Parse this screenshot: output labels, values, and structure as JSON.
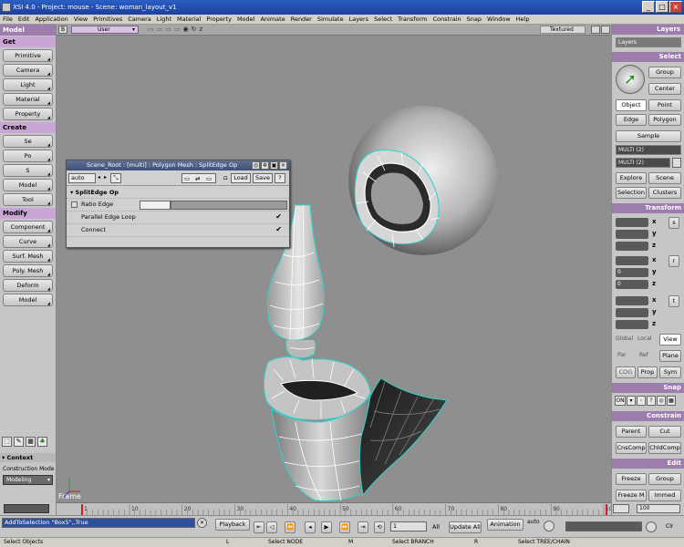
{
  "window": {
    "title": "XSI 4.0 - Project: mouse - Scene: woman_layout_v1"
  },
  "menu": [
    "File",
    "Edit",
    "Application",
    "View",
    "Primitives",
    "Camera",
    "Light",
    "Material",
    "Property",
    "Model",
    "Animate",
    "Render",
    "Simulate",
    "Layers",
    "Select",
    "Transform",
    "Constrain",
    "Snap",
    "Window",
    "Help"
  ],
  "left": {
    "model_tab": "Model",
    "get_header": "Get",
    "get_buttons": [
      "Primitive",
      "Camera",
      "Light",
      "Material",
      "Property"
    ],
    "create_header": "Create",
    "create_partial": [
      "Se",
      "Po",
      "S",
      "Model",
      "Tool"
    ],
    "modify_header": "Modify",
    "modify_buttons": [
      "Component",
      "Curve",
      "Surf. Mesh",
      "Poly. Mesh",
      "Deform",
      "Model"
    ],
    "context_label": "Context",
    "construction_mode_label": "Construction Mode",
    "construction_mode_value": "Modeling"
  },
  "viewport": {
    "camera": "User",
    "display_mode": "Textured",
    "frame_label": "Frame"
  },
  "ppg": {
    "title": "Scene_Root : [multi] : Polygon Mesh : SplitEdge Op",
    "auto_label": "auto",
    "load_label": "Load",
    "save_label": "Save",
    "help_label": "?",
    "section": "SplitEdge Op",
    "ratio_label": "Ratio Edge",
    "parallel_label": "Parallel Edge Loop",
    "connect_label": "Connect"
  },
  "right": {
    "layers_header": "Layers",
    "layer_value": "Layers",
    "select_header": "Select",
    "group": "Group",
    "center": "Center",
    "object": "Object",
    "point": "Point",
    "edge": "Edge",
    "polygon": "Polygon",
    "sample": "Sample",
    "multi1": "MULTI (2)",
    "multi2": "MULTI (2)",
    "explore": "Explore",
    "scene": "Scene",
    "selection": "Selection",
    "clusters": "Clusters",
    "transform_header": "Transform",
    "axis_s": "s",
    "axis_r": "r",
    "axis_t": "t",
    "axis_x": "x",
    "axis_y": "y",
    "axis_z": "z",
    "r_x_value": "0",
    "r_y_value": "0",
    "global": "Global",
    "local": "Local",
    "view": "View",
    "par": "Par",
    "ref": "Ref",
    "plane": "Plane",
    "cog": "COG",
    "prop": "Prop",
    "sym": "Sym",
    "snap_header": "Snap",
    "snap_on": "ON",
    "constrain_header": "Constrain",
    "parent": "Parent",
    "cut": "Cut",
    "cnscomp": "CnsComp",
    "chldcomp": "ChldComp",
    "edit_header": "Edit",
    "freeze": "Freeze",
    "edit_group": "Group",
    "freeze_m": "Freeze M",
    "immed": "Immed"
  },
  "timeline": {
    "ticks": [
      "1",
      "10",
      "20",
      "30",
      "40",
      "50",
      "60",
      "70",
      "80",
      "90",
      "100"
    ],
    "start": "1",
    "end": "100"
  },
  "playbar": {
    "script_line": "AddToSelection \"Box5\",,True",
    "playback": "Playback",
    "frame_value": "1",
    "all_label": "All",
    "update_all": "Update All",
    "animation": "Animation",
    "auto_label": "auto"
  },
  "status": {
    "select_objects": "Select Objects",
    "l_key": "L",
    "select_node": "Select NODE",
    "m_key": "M",
    "select_branch": "Select BRANCH",
    "r_key": "R",
    "select_tree": "Select TREE/CHAIN"
  }
}
